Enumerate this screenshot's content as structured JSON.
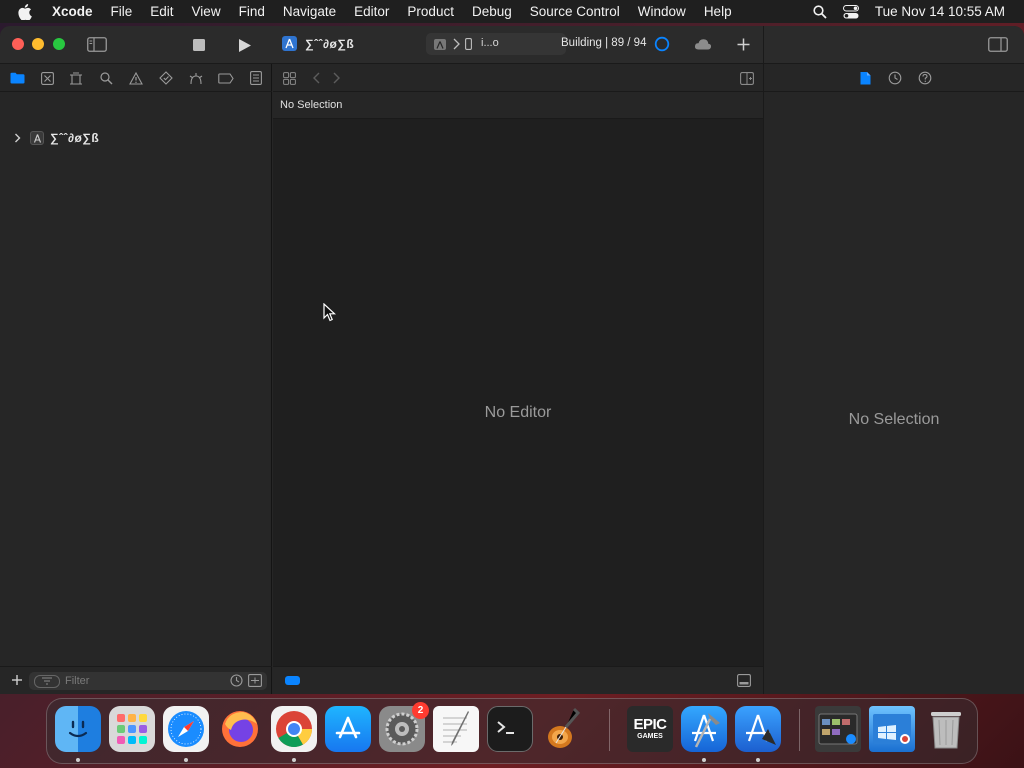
{
  "menubar": {
    "app_name": "Xcode",
    "items": [
      "File",
      "Edit",
      "View",
      "Find",
      "Navigate",
      "Editor",
      "Product",
      "Debug",
      "Source Control",
      "Window",
      "Help"
    ],
    "clock": "Tue Nov 14  10:55 AM"
  },
  "toolbar": {
    "scheme_name": "∑ˆˆ∂ø∑ß",
    "destination": "i...o",
    "build_status": "Building | 89 / 94"
  },
  "navigator": {
    "project_name": "∑ˆˆ∂ø∑ß",
    "filter_placeholder": "Filter"
  },
  "editor": {
    "jumpbar_text": "No Selection",
    "empty_message": "No Editor"
  },
  "inspector": {
    "empty_message": "No Selection"
  },
  "dock": {
    "items": [
      "Finder",
      "Launchpad",
      "Safari",
      "Firefox",
      "Chrome",
      "App Store",
      "System Settings",
      "TextEdit",
      "Terminal",
      "GarageBand",
      "Epic Games",
      "Xcode",
      "Instruments",
      "Finder Window",
      "Windows App",
      "Trash"
    ],
    "settings_badge": "2",
    "epic_label_top": "EPIC",
    "epic_label_bottom": "GAMES"
  },
  "colors": {
    "accent": "#0a84ff",
    "close": "#ff5f57",
    "minimize": "#febc2e",
    "zoom": "#28c840"
  }
}
